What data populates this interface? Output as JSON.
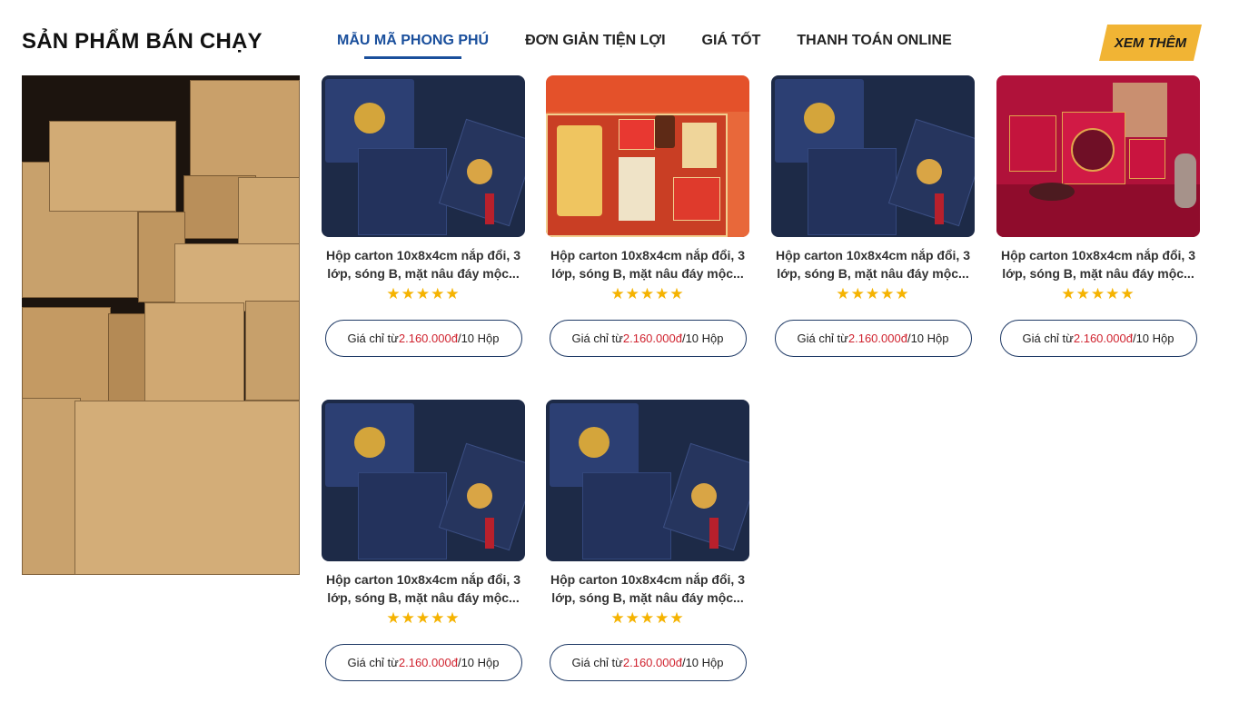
{
  "section": {
    "title": "SẢN PHẨM BÁN CHẠY"
  },
  "tabs": [
    {
      "label": "MẪU MÃ PHONG PHÚ",
      "active": true
    },
    {
      "label": "ĐƠN GIẢN TIỆN LỢI",
      "active": false
    },
    {
      "label": "GIÁ TỐT",
      "active": false
    },
    {
      "label": "THANH TOÁN ONLINE",
      "active": false
    }
  ],
  "more_button": {
    "label": "XEM THÊM"
  },
  "colors": {
    "accent": "#1a4f9c",
    "button_yellow": "#f1b434",
    "price_red": "#d0232f",
    "star": "#f5b301",
    "outline": "#1f3a66"
  },
  "banner": {
    "image": "cardboard-boxes-photo"
  },
  "products": [
    {
      "image": "navy-gift-box",
      "name": "Hộp carton 10x8x4cm nắp đổi, 3 lớp, sóng B, mặt nâu đáy mộc...",
      "rating": 5,
      "price_prefix": "Giá chỉ từ ",
      "price": "2.160.000đ",
      "price_suffix": "/10 Hộp"
    },
    {
      "image": "red-ginseng-gift-box",
      "name": "Hộp carton 10x8x4cm nắp đổi, 3 lớp, sóng B, mặt nâu đáy mộc...",
      "rating": 5,
      "price_prefix": "Giá chỉ từ ",
      "price": "2.160.000đ",
      "price_suffix": "/10 Hộp"
    },
    {
      "image": "navy-gift-box",
      "name": "Hộp carton 10x8x4cm nắp đổi, 3 lớp, sóng B, mặt nâu đáy mộc...",
      "rating": 5,
      "price_prefix": "Giá chỉ từ ",
      "price": "2.160.000đ",
      "price_suffix": "/10 Hộp"
    },
    {
      "image": "red-mooncake-gift-box",
      "name": "Hộp carton 10x8x4cm nắp đổi, 3 lớp, sóng B, mặt nâu đáy mộc...",
      "rating": 5,
      "price_prefix": "Giá chỉ từ ",
      "price": "2.160.000đ",
      "price_suffix": "/10 Hộp"
    },
    {
      "image": "navy-gift-box",
      "name": "Hộp carton 10x8x4cm nắp đổi, 3 lớp, sóng B, mặt nâu đáy mộc...",
      "rating": 5,
      "price_prefix": "Giá chỉ từ ",
      "price": "2.160.000đ",
      "price_suffix": "/10 Hộp"
    },
    {
      "image": "navy-gift-box",
      "name": "Hộp carton 10x8x4cm nắp đổi, 3 lớp, sóng B, mặt nâu đáy mộc...",
      "rating": 5,
      "price_prefix": "Giá chỉ từ ",
      "price": "2.160.000đ",
      "price_suffix": "/10 Hộp"
    }
  ]
}
